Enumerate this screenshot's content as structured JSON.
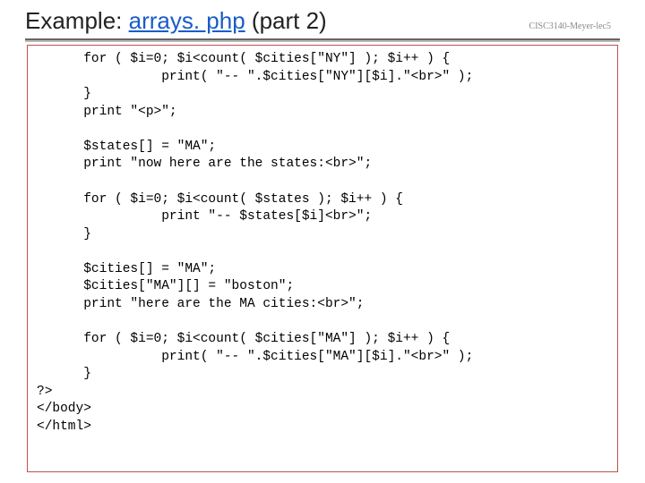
{
  "title_prefix": "Example: ",
  "title_link": "arrays. php",
  "title_suffix": " (part 2)",
  "stamp": "CISC3140-Meyer-lec5",
  "code": "      for ( $i=0; $i<count( $cities[\"NY\"] ); $i++ ) {\n                print( \"-- \".$cities[\"NY\"][$i].\"<br>\" );\n      }\n      print \"<p>\";\n\n      $states[] = \"MA\";\n      print \"now here are the states:<br>\";\n\n      for ( $i=0; $i<count( $states ); $i++ ) {\n                print \"-- $states[$i]<br>\";\n      }\n\n      $cities[] = \"MA\";\n      $cities[\"MA\"][] = \"boston\";\n      print \"here are the MA cities:<br>\";\n\n      for ( $i=0; $i<count( $cities[\"MA\"] ); $i++ ) {\n                print( \"-- \".$cities[\"MA\"][$i].\"<br>\" );\n      }\n?>\n</body>\n</html>"
}
